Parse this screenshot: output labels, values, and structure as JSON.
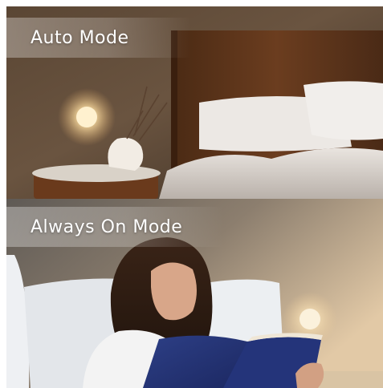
{
  "panels": [
    {
      "mode_label": "Auto Mode",
      "scene": "bedside-night-light-scene"
    },
    {
      "mode_label": "Always On Mode",
      "scene": "reading-in-bed-scene"
    }
  ],
  "colors": {
    "label_text": "#ffffff",
    "night_light_glow": "#f6d9a0",
    "wall_warm": "#caa882"
  }
}
